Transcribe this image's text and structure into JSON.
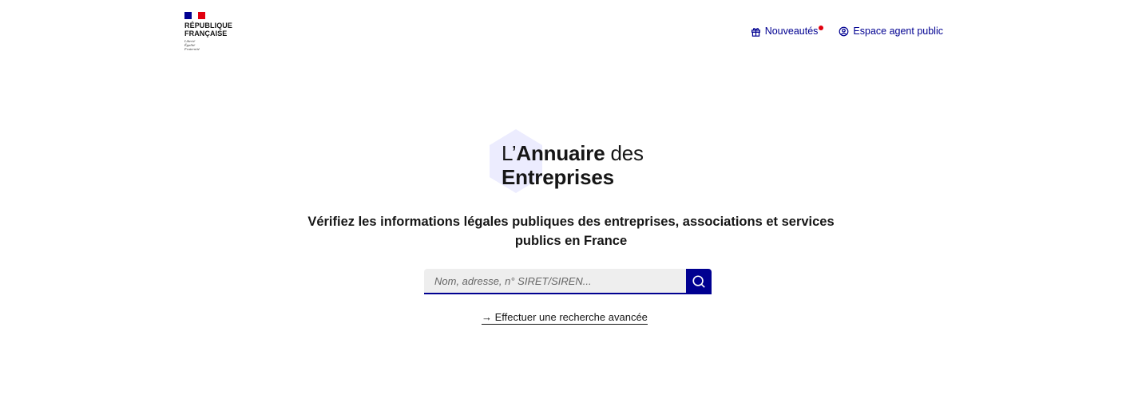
{
  "header": {
    "logo": {
      "name_line1": "RÉPUBLIQUE",
      "name_line2": "FRANÇAISE",
      "motto": [
        "Liberté",
        "Égalité",
        "Fraternité"
      ],
      "flag_colors": [
        "#000091",
        "#ffffff",
        "#e1000f"
      ]
    },
    "nav": {
      "news_label": "Nouveautés",
      "news_icon": "gift-icon",
      "news_has_notification": true,
      "agent_label": "Espace agent public",
      "agent_icon": "user-circle-icon"
    }
  },
  "brand": {
    "prefix": "L’",
    "bold1": "Annuaire",
    "suffix": " des",
    "bold2": "Entreprises"
  },
  "hero": {
    "tagline": "Vérifiez les informations légales publiques des entreprises, associations et services publics en France"
  },
  "search": {
    "placeholder": "Nom, adresse, n° SIRET/SIREN...",
    "value": "",
    "button_icon": "search-icon"
  },
  "advanced_search": {
    "arrow": "→",
    "label": "Effectuer une recherche avancée"
  },
  "colors": {
    "primary": "#000091",
    "accent_red": "#e1000f",
    "hexagon": "#ececfe",
    "input_bg": "#eeeeee"
  }
}
